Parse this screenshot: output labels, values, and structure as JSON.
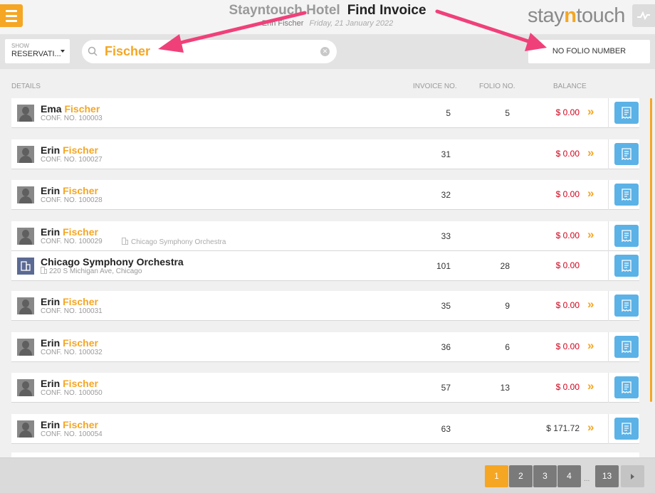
{
  "header": {
    "hotel": "Stayntouch Hotel",
    "page_title": "Find Invoice",
    "user": "Erin Fischer",
    "date": "Friday, 21 January 2022",
    "logo_prefix": "stay",
    "logo_n": "n",
    "logo_suffix": "touch"
  },
  "filters": {
    "show_label": "SHOW",
    "show_value": "RESERVATI...",
    "search_value": "Fischer",
    "folio_filter": "NO FOLIO NUMBER"
  },
  "columns": {
    "details": "DETAILS",
    "invoice": "INVOICE NO.",
    "folio": "FOLIO NO.",
    "balance": "BALANCE"
  },
  "rows": [
    {
      "first": "Ema",
      "last": "Fischer",
      "conf": "CONF. NO. 100003",
      "invoice": "5",
      "folio": "5",
      "balance": "$ 0.00"
    },
    {
      "first": "Erin",
      "last": "Fischer",
      "conf": "CONF. NO. 100027",
      "invoice": "31",
      "folio": "",
      "balance": "$ 0.00"
    },
    {
      "first": "Erin",
      "last": "Fischer",
      "conf": "CONF. NO. 100028",
      "invoice": "32",
      "folio": "",
      "balance": "$ 0.00"
    },
    {
      "first": "Erin",
      "last": "Fischer",
      "conf": "CONF. NO. 100029",
      "company": "Chicago Symphony Orchestra",
      "invoice": "33",
      "folio": "",
      "balance": "$ 0.00"
    },
    {
      "first": "Erin",
      "last": "Fischer",
      "conf": "CONF. NO. 100031",
      "invoice": "35",
      "folio": "9",
      "balance": "$ 0.00"
    },
    {
      "first": "Erin",
      "last": "Fischer",
      "conf": "CONF. NO. 100032",
      "invoice": "36",
      "folio": "6",
      "balance": "$ 0.00"
    },
    {
      "first": "Erin",
      "last": "Fischer",
      "conf": "CONF. NO. 100050",
      "invoice": "57",
      "folio": "13",
      "balance": "$ 0.00"
    },
    {
      "first": "Erin",
      "last": "Fischer",
      "conf": "CONF. NO. 100054",
      "invoice": "63",
      "folio": "",
      "balance": "$ 171.72"
    }
  ],
  "company_row": {
    "name": "Chicago Symphony Orchestra",
    "address": "220 S Michigan Ave, Chicago",
    "invoice": "101",
    "folio": "28",
    "balance": "$ 0.00"
  },
  "pagination": {
    "pages": [
      "1",
      "2",
      "3",
      "4"
    ],
    "dots": "...",
    "last": "13",
    "current": "1"
  },
  "colors": {
    "accent": "#f5a623",
    "negative_balance": "#d0021b",
    "action_blue": "#5bb2e6",
    "annotation_arrow": "#f0407a"
  }
}
